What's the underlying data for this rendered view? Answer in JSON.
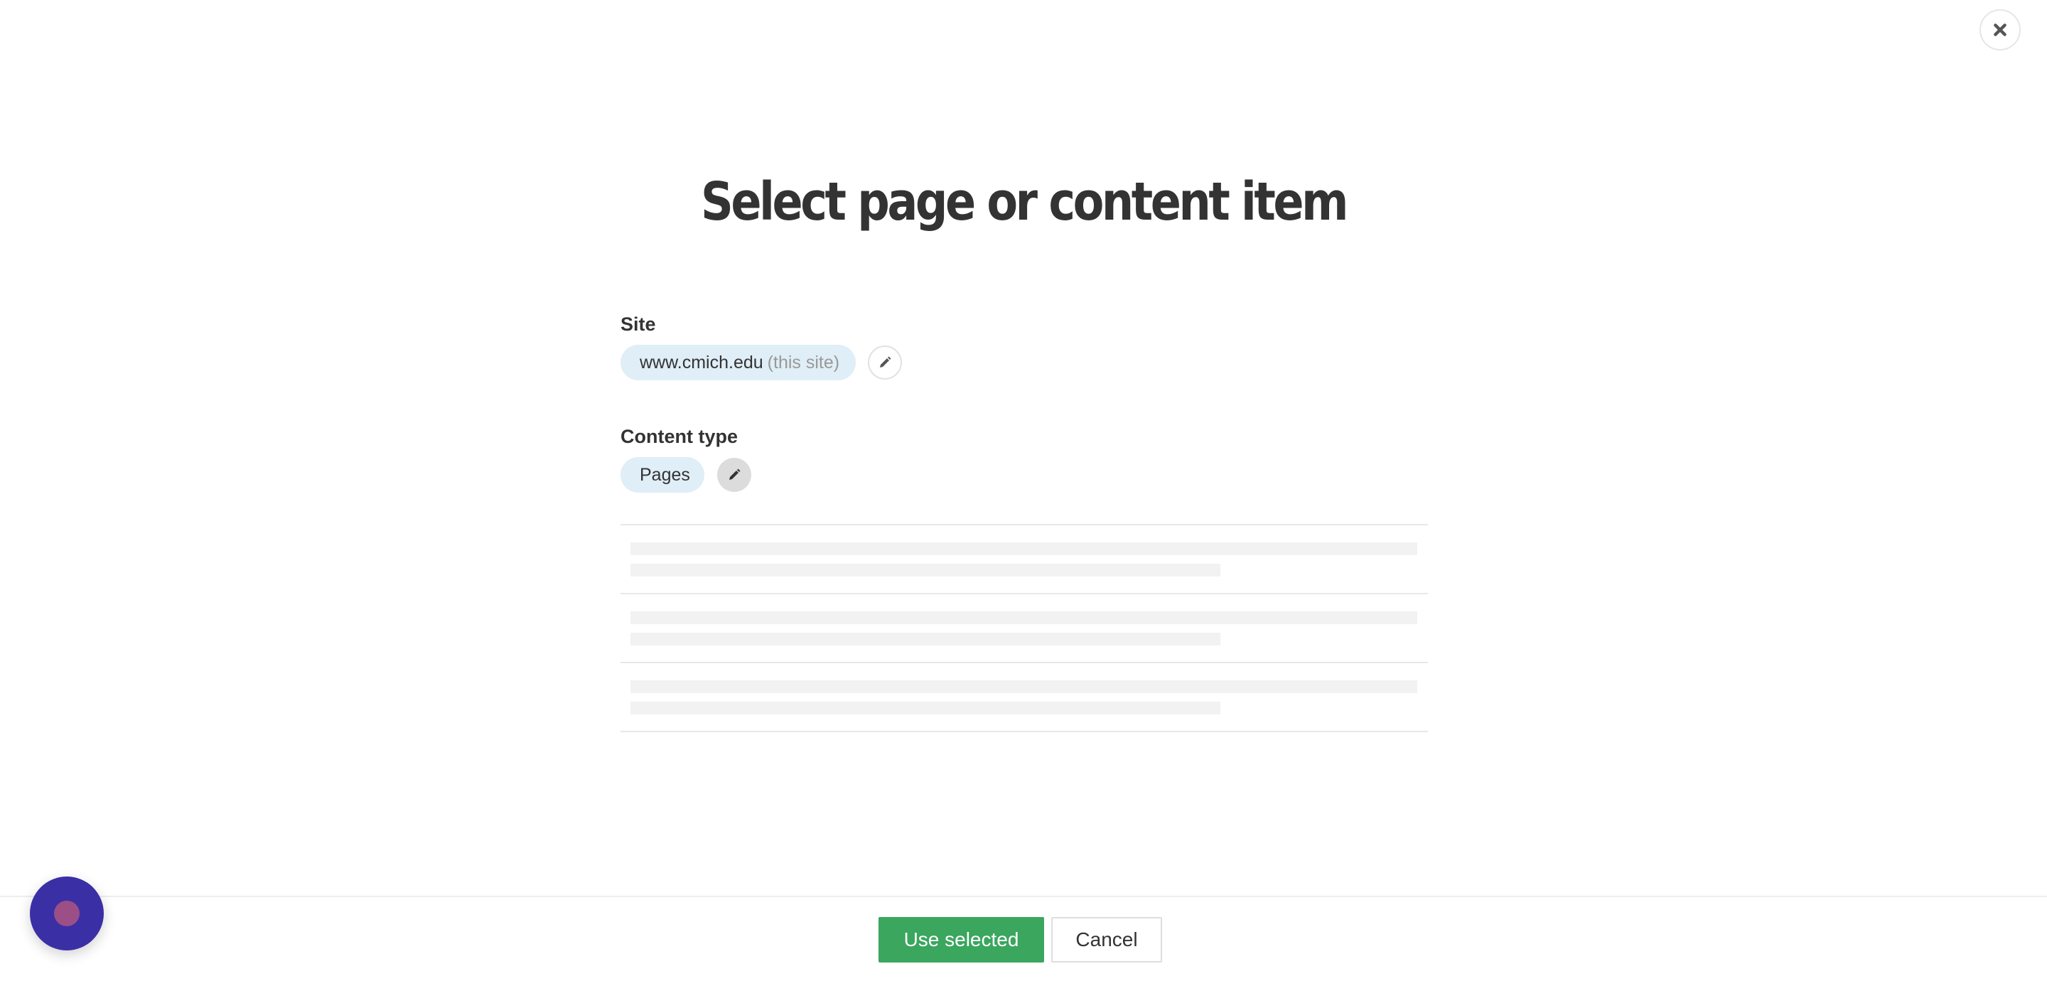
{
  "dialog": {
    "title": "Select page or content item",
    "close_icon": "close-icon"
  },
  "site": {
    "label": "Site",
    "value": "www.cmich.edu",
    "note": "(this site)",
    "edit_icon": "pencil-icon"
  },
  "content_type": {
    "label": "Content type",
    "value": "Pages",
    "edit_icon": "pencil-icon"
  },
  "results": {
    "state": "loading",
    "placeholder_rows": 3
  },
  "footer": {
    "use_selected_label": "Use selected",
    "cancel_label": "Cancel"
  },
  "chat_widget": {
    "icon": "chat-launcher-icon"
  },
  "colors": {
    "primary_button": "#3aa65e",
    "pill_background": "#dfeef7",
    "chat_widget": "#3b2fa6"
  }
}
